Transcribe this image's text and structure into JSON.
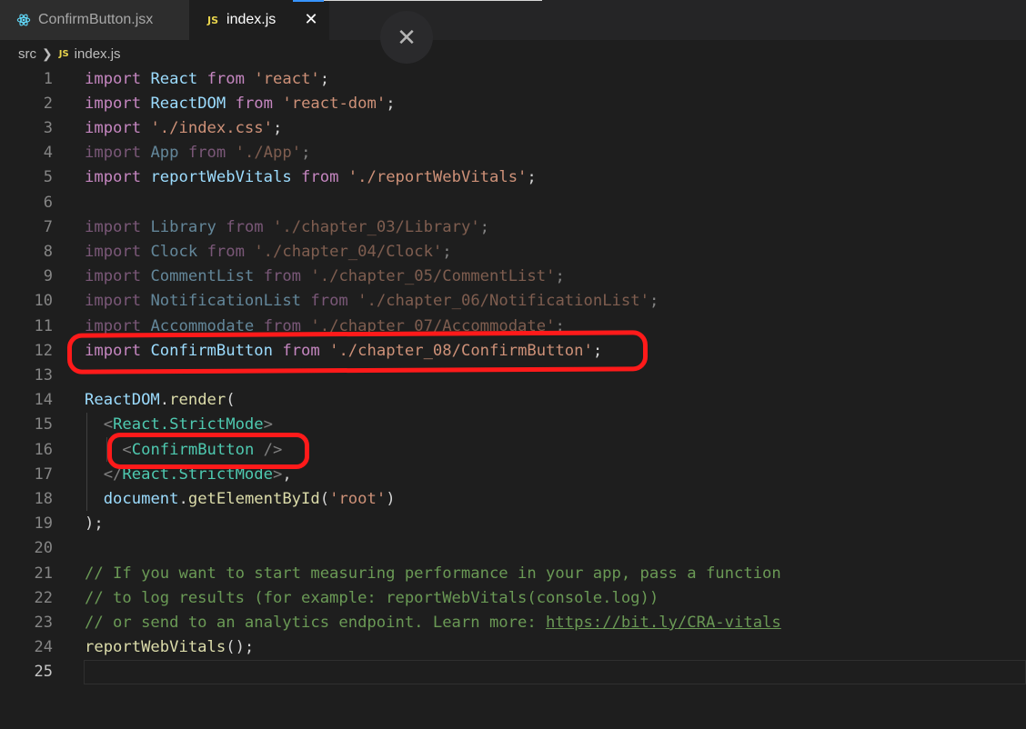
{
  "tabs": [
    {
      "label": "ConfirmButton.jsx",
      "icon": "react-icon",
      "active": false
    },
    {
      "label": "index.js",
      "icon": "js-icon",
      "icon_text": "JS",
      "active": true
    }
  ],
  "breadcrumb": {
    "folder": "src",
    "file_icon_text": "JS",
    "file": "index.js"
  },
  "close_glyph": "✕",
  "colors": {
    "keyword": "#c586c0",
    "variable": "#9cdcfe",
    "string": "#ce9178",
    "function": "#dcdcaa",
    "component": "#4ec9b0",
    "comment": "#6a9955",
    "annotation": "#ff1a1a",
    "editor_bg": "#1e1e1e"
  },
  "editor": {
    "active_line": 25,
    "lines": [
      {
        "n": "1",
        "t": [
          [
            "kw",
            "import"
          ],
          [
            "plain",
            " "
          ],
          [
            "var",
            "React"
          ],
          [
            "plain",
            " "
          ],
          [
            "kw",
            "from"
          ],
          [
            "plain",
            " "
          ],
          [
            "str",
            "'react'"
          ],
          [
            "plain",
            ";"
          ]
        ]
      },
      {
        "n": "2",
        "t": [
          [
            "kw",
            "import"
          ],
          [
            "plain",
            " "
          ],
          [
            "var",
            "ReactDOM"
          ],
          [
            "plain",
            " "
          ],
          [
            "kw",
            "from"
          ],
          [
            "plain",
            " "
          ],
          [
            "str",
            "'react-dom'"
          ],
          [
            "plain",
            ";"
          ]
        ]
      },
      {
        "n": "3",
        "t": [
          [
            "kw",
            "import"
          ],
          [
            "plain",
            " "
          ],
          [
            "str",
            "'./index.css'"
          ],
          [
            "plain",
            ";"
          ]
        ]
      },
      {
        "n": "4",
        "faded": true,
        "t": [
          [
            "kw",
            "import"
          ],
          [
            "plain",
            " "
          ],
          [
            "var",
            "App"
          ],
          [
            "plain",
            " "
          ],
          [
            "kw",
            "from"
          ],
          [
            "plain",
            " "
          ],
          [
            "str",
            "'./App'"
          ],
          [
            "plain",
            ";"
          ]
        ]
      },
      {
        "n": "5",
        "t": [
          [
            "kw",
            "import"
          ],
          [
            "plain",
            " "
          ],
          [
            "var",
            "reportWebVitals"
          ],
          [
            "plain",
            " "
          ],
          [
            "kw",
            "from"
          ],
          [
            "plain",
            " "
          ],
          [
            "str",
            "'./reportWebVitals'"
          ],
          [
            "plain",
            ";"
          ]
        ]
      },
      {
        "n": "6",
        "t": []
      },
      {
        "n": "7",
        "faded": true,
        "t": [
          [
            "kw",
            "import"
          ],
          [
            "plain",
            " "
          ],
          [
            "var",
            "Library"
          ],
          [
            "plain",
            " "
          ],
          [
            "kw",
            "from"
          ],
          [
            "plain",
            " "
          ],
          [
            "str",
            "'./chapter_03/Library'"
          ],
          [
            "plain",
            ";"
          ]
        ]
      },
      {
        "n": "8",
        "faded": true,
        "t": [
          [
            "kw",
            "import"
          ],
          [
            "plain",
            " "
          ],
          [
            "var",
            "Clock"
          ],
          [
            "plain",
            " "
          ],
          [
            "kw",
            "from"
          ],
          [
            "plain",
            " "
          ],
          [
            "str",
            "'./chapter_04/Clock'"
          ],
          [
            "plain",
            ";"
          ]
        ]
      },
      {
        "n": "9",
        "faded": true,
        "t": [
          [
            "kw",
            "import"
          ],
          [
            "plain",
            " "
          ],
          [
            "var",
            "CommentList"
          ],
          [
            "plain",
            " "
          ],
          [
            "kw",
            "from"
          ],
          [
            "plain",
            " "
          ],
          [
            "str",
            "'./chapter_05/CommentList'"
          ],
          [
            "plain",
            ";"
          ]
        ]
      },
      {
        "n": "10",
        "faded": true,
        "t": [
          [
            "kw",
            "import"
          ],
          [
            "plain",
            " "
          ],
          [
            "var",
            "NotificationList"
          ],
          [
            "plain",
            " "
          ],
          [
            "kw",
            "from"
          ],
          [
            "plain",
            " "
          ],
          [
            "str",
            "'./chapter_06/NotificationList'"
          ],
          [
            "plain",
            ";"
          ]
        ]
      },
      {
        "n": "11",
        "faded": true,
        "t": [
          [
            "kw",
            "import"
          ],
          [
            "plain",
            " "
          ],
          [
            "var",
            "Accommodate"
          ],
          [
            "plain",
            " "
          ],
          [
            "kw",
            "from"
          ],
          [
            "plain",
            " "
          ],
          [
            "str",
            "'./chapter_07/Accommodate'"
          ],
          [
            "plain",
            ";"
          ]
        ]
      },
      {
        "n": "12",
        "t": [
          [
            "kw",
            "import"
          ],
          [
            "plain",
            " "
          ],
          [
            "var",
            "ConfirmButton"
          ],
          [
            "plain",
            " "
          ],
          [
            "kw",
            "from"
          ],
          [
            "plain",
            " "
          ],
          [
            "str",
            "'./chapter_08/ConfirmButton'"
          ],
          [
            "plain",
            ";"
          ]
        ]
      },
      {
        "n": "13",
        "t": []
      },
      {
        "n": "14",
        "t": [
          [
            "var",
            "ReactDOM"
          ],
          [
            "plain",
            "."
          ],
          [
            "fn",
            "render"
          ],
          [
            "plain",
            "("
          ]
        ]
      },
      {
        "n": "15",
        "t": [
          [
            "plain",
            "  "
          ],
          [
            "tag",
            "<"
          ],
          [
            "cls",
            "React.StrictMode"
          ],
          [
            "tag",
            ">"
          ]
        ]
      },
      {
        "n": "16",
        "t": [
          [
            "plain",
            "    "
          ],
          [
            "tag",
            "<"
          ],
          [
            "cls",
            "ConfirmButton"
          ],
          [
            "plain",
            " "
          ],
          [
            "tag",
            "/>"
          ]
        ]
      },
      {
        "n": "17",
        "t": [
          [
            "plain",
            "  "
          ],
          [
            "tag",
            "</"
          ],
          [
            "cls",
            "React.StrictMode"
          ],
          [
            "tag",
            ">"
          ],
          [
            "plain",
            ","
          ]
        ]
      },
      {
        "n": "18",
        "t": [
          [
            "plain",
            "  "
          ],
          [
            "var",
            "document"
          ],
          [
            "plain",
            "."
          ],
          [
            "fn",
            "getElementById"
          ],
          [
            "plain",
            "("
          ],
          [
            "str",
            "'root'"
          ],
          [
            "plain",
            ")"
          ]
        ]
      },
      {
        "n": "19",
        "t": [
          [
            "plain",
            ");"
          ]
        ]
      },
      {
        "n": "20",
        "t": []
      },
      {
        "n": "21",
        "t": [
          [
            "cmt",
            "// If you want to start measuring performance in your app, pass a function"
          ]
        ]
      },
      {
        "n": "22",
        "t": [
          [
            "cmt",
            "// to log results (for example: reportWebVitals(console.log))"
          ]
        ]
      },
      {
        "n": "23",
        "t": [
          [
            "cmt",
            "// or send to an analytics endpoint. Learn more: "
          ],
          [
            "link",
            "https://bit.ly/CRA-vitals"
          ]
        ]
      },
      {
        "n": "24",
        "t": [
          [
            "fn",
            "reportWebVitals"
          ],
          [
            "plain",
            "();"
          ]
        ]
      },
      {
        "n": "25",
        "t": []
      }
    ]
  }
}
